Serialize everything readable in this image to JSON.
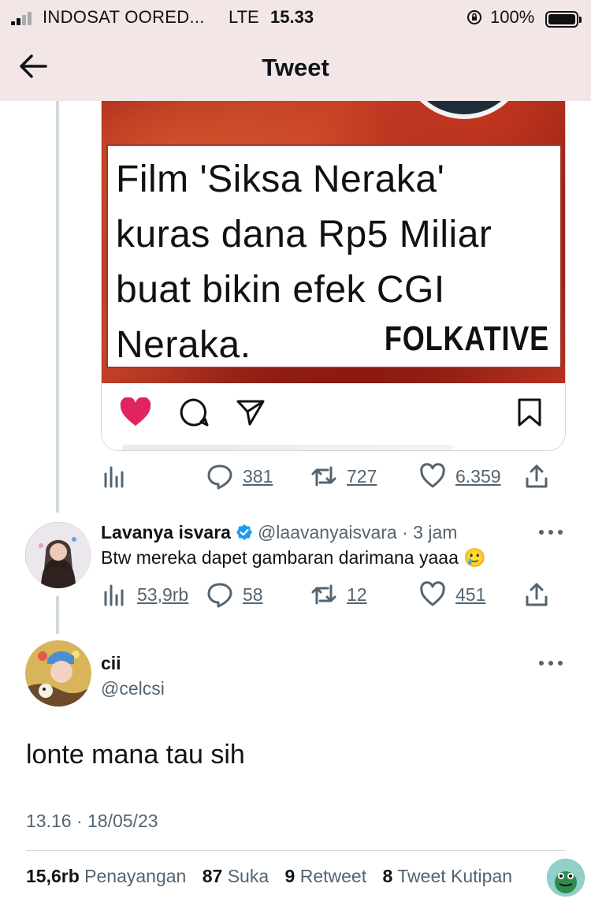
{
  "status_bar": {
    "carrier": "INDOSAT OORED...",
    "network": "LTE",
    "time": "15.33",
    "battery": "100%"
  },
  "header": {
    "title": "Tweet"
  },
  "quoted_image": {
    "text_lines": [
      "Film 'Siksa Neraka'",
      "kuras dana Rp5 Miliar",
      "buat bikin efek CGI",
      "Neraka."
    ],
    "brand": "FOLKATIVE"
  },
  "parent_actions": {
    "replies": "381",
    "retweets": "727",
    "likes": "6.359"
  },
  "reply": {
    "name": "Lavanya isvara",
    "handle_time": "@laavanyaisvara · 3 jam",
    "text": "Btw mereka dapet gambaran darimana yaaa 🥲",
    "views": "53,9rb",
    "replies": "58",
    "retweets": "12",
    "likes": "451"
  },
  "main": {
    "name": "cii",
    "handle": "@celcsi",
    "text": "lonte mana tau sih",
    "timestamp": "13.16 · 18/05/23",
    "stats": {
      "views_num": "15,6rb",
      "views_label": "Penayangan",
      "likes_num": "87",
      "likes_label": "Suka",
      "retweets_num": "9",
      "retweets_label": "Retweet",
      "quotes_num": "8",
      "quotes_label": "Tweet Kutipan"
    }
  },
  "colors": {
    "like_red": "#e0245e",
    "muted": "#536471",
    "verified_blue": "#1d9bf0"
  }
}
